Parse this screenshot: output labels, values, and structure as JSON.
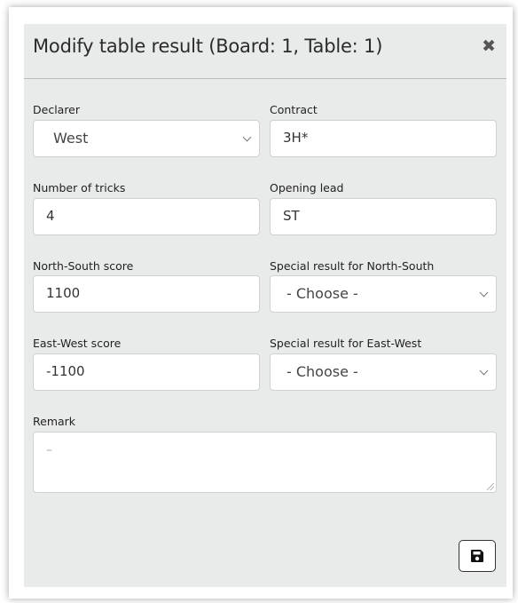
{
  "dialog": {
    "title": "Modify table result (Board: 1, Table: 1)",
    "close_glyph": "✖"
  },
  "fields": {
    "declarer": {
      "label": "Declarer",
      "value": "West"
    },
    "contract": {
      "label": "Contract",
      "value": "3H*"
    },
    "tricks": {
      "label": "Number of tricks",
      "value": "4"
    },
    "opening_lead": {
      "label": "Opening lead",
      "value": "ST"
    },
    "ns_score": {
      "label": "North-South score",
      "value": "1100"
    },
    "ns_special": {
      "label": "Special result for North-South",
      "value": "- Choose -"
    },
    "ew_score": {
      "label": "East-West score",
      "value": "-1100"
    },
    "ew_special": {
      "label": "Special result for East-West",
      "value": "- Choose -"
    },
    "remark": {
      "label": "Remark",
      "placeholder": "–"
    }
  },
  "icons": {
    "close": "close-icon",
    "save": "floppy-disk-icon"
  }
}
